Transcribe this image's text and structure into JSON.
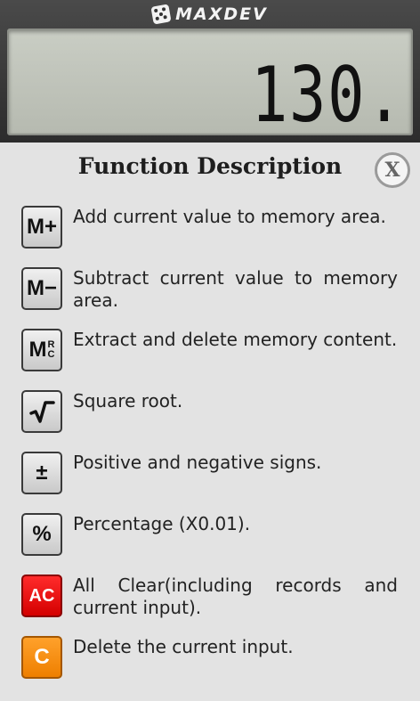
{
  "header": {
    "brand": "MAXDEV",
    "display_value": "130."
  },
  "dialog": {
    "title": "Function Description",
    "close_label": "X",
    "items": [
      {
        "key": "M+",
        "style": "gray",
        "text": "Add current value to memory area."
      },
      {
        "key": "M−",
        "style": "gray",
        "text": "Subtract current value to memory area."
      },
      {
        "key": "M",
        "key_sup": [
          "R",
          "C"
        ],
        "style": "gray",
        "text": "Extract and delete memory content."
      },
      {
        "key": "√‾",
        "style": "gray",
        "text": "Square root."
      },
      {
        "key": "±",
        "style": "gray",
        "text": "Positive and negative signs."
      },
      {
        "key": "%",
        "style": "gray",
        "text": "Percentage (X0.01)."
      },
      {
        "key": "AC",
        "style": "red",
        "color": "#e60000",
        "text": "All Clear(including records and current input)."
      },
      {
        "key": "C",
        "style": "orange",
        "color": "#ff8c00",
        "text": "Delete the current input."
      }
    ]
  }
}
